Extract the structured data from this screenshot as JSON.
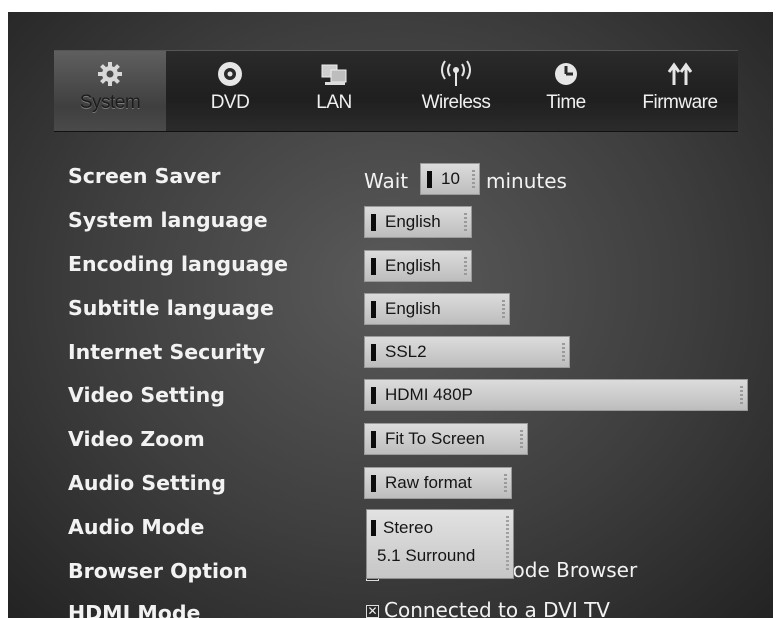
{
  "tabs": [
    {
      "label": "System",
      "icon": "gear-icon",
      "active": true
    },
    {
      "label": "DVD",
      "icon": "disc-icon",
      "active": false
    },
    {
      "label": "LAN",
      "icon": "network-computers-icon",
      "active": false
    },
    {
      "label": "Wireless",
      "icon": "wireless-antenna-icon",
      "active": false
    },
    {
      "label": "Time",
      "icon": "clock-icon",
      "active": false
    },
    {
      "label": "Firmware",
      "icon": "up-down-arrows-icon",
      "active": false
    }
  ],
  "settings": {
    "screen_saver": {
      "label": "Screen Saver",
      "prefix": "Wait",
      "value": "10",
      "suffix": "minutes"
    },
    "system_language": {
      "label": "System language",
      "value": "English"
    },
    "encoding_language": {
      "label": "Encoding language",
      "value": "English"
    },
    "subtitle_language": {
      "label": "Subtitle language",
      "value": "English"
    },
    "internet_security": {
      "label": "Internet Security",
      "value": "SSL2"
    },
    "video_setting": {
      "label": "Video Setting",
      "value": "HDMI 480P"
    },
    "video_zoom": {
      "label": "Video Zoom",
      "value": "Fit To Screen"
    },
    "audio_setting": {
      "label": "Audio Setting",
      "value": "Raw format"
    },
    "audio_mode": {
      "label": "Audio Mode",
      "options": [
        "Stereo",
        "5.1 Surround"
      ],
      "selected": "Stereo"
    },
    "browser_option": {
      "label": "Browser Option",
      "checkbox_label": "Enable HD Mode Browser",
      "checked": false
    },
    "hdmi_mode": {
      "label": "HDMI Mode",
      "checkbox_label": "Connected to a DVI TV",
      "checked": true
    }
  }
}
